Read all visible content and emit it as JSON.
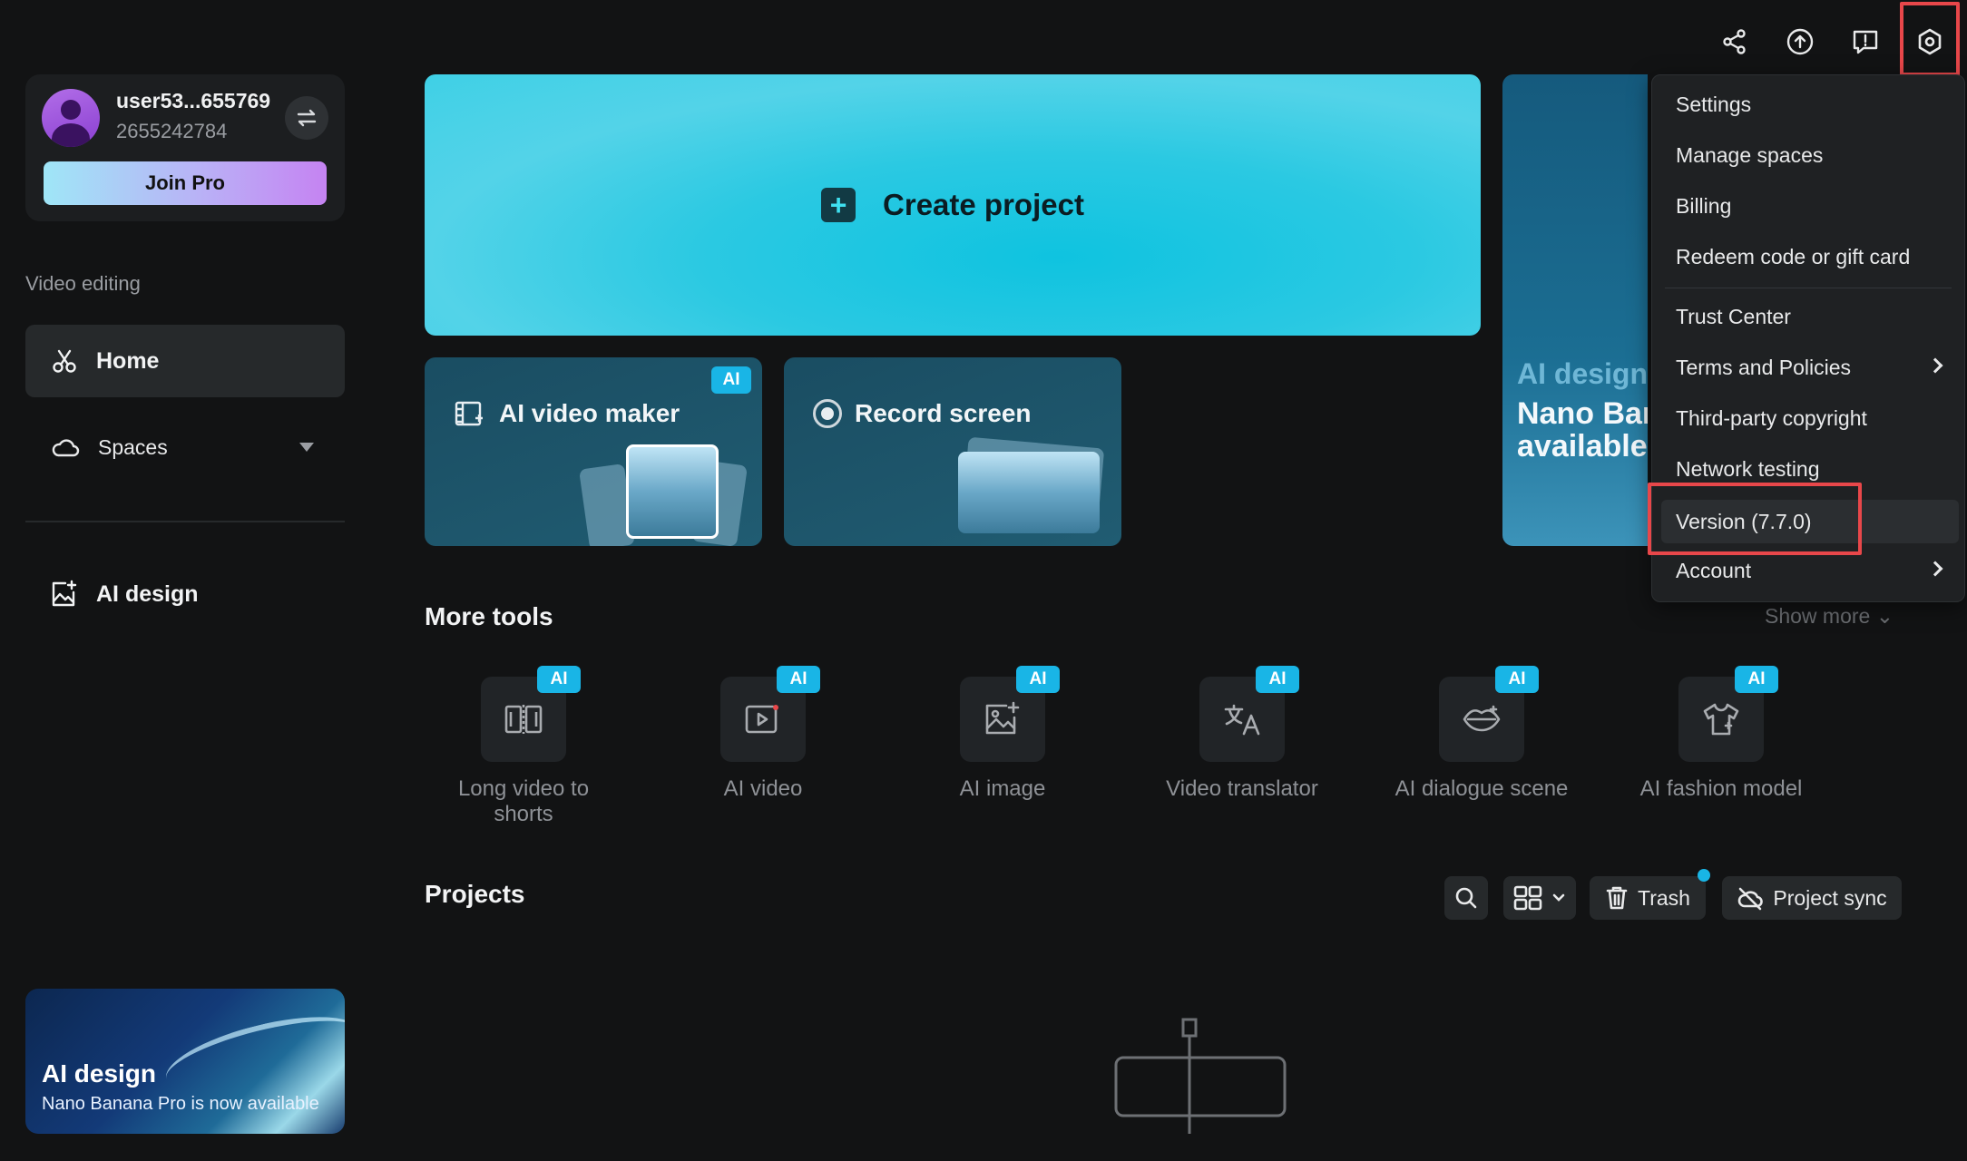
{
  "sidebar": {
    "user": {
      "name": "user53...655769",
      "id": "2655242784"
    },
    "join_pro": "Join Pro",
    "section_label": "Video editing",
    "nav": {
      "home": "Home",
      "spaces": "Spaces",
      "ai_design": "AI design"
    },
    "promo": {
      "title": "AI design",
      "subtitle": "Nano Banana Pro is now available"
    }
  },
  "main": {
    "create_project": "Create project",
    "banner": {
      "line1": "AI design",
      "line2": "Nano Ban",
      "line3": "available"
    },
    "cards": [
      {
        "label": "AI video maker",
        "badge": "AI"
      },
      {
        "label": "Record screen"
      }
    ],
    "more_tools": {
      "title": "More tools",
      "show_more": "Show more"
    },
    "tools": [
      {
        "line1": "Long video to",
        "line2": "shorts",
        "badge": "AI"
      },
      {
        "line1": "AI video",
        "line2": "",
        "badge": "AI"
      },
      {
        "line1": "AI image",
        "line2": "",
        "badge": "AI"
      },
      {
        "line1": "Video translator",
        "line2": "",
        "badge": "AI"
      },
      {
        "line1": "AI dialogue scene",
        "line2": "",
        "badge": "AI"
      },
      {
        "line1": "AI fashion model",
        "line2": "",
        "badge": "AI"
      }
    ],
    "projects": {
      "title": "Projects",
      "trash": "Trash",
      "project_sync": "Project sync"
    }
  },
  "menu": {
    "items": [
      "Settings",
      "Manage spaces",
      "Billing",
      "Redeem code or gift card",
      "Trust Center",
      "Terms and Policies",
      "Third-party copyright",
      "Network testing",
      "Version (7.7.0)",
      "Account"
    ]
  },
  "colors": {
    "accent": "#19b5e6",
    "highlight": "#e8474a"
  }
}
